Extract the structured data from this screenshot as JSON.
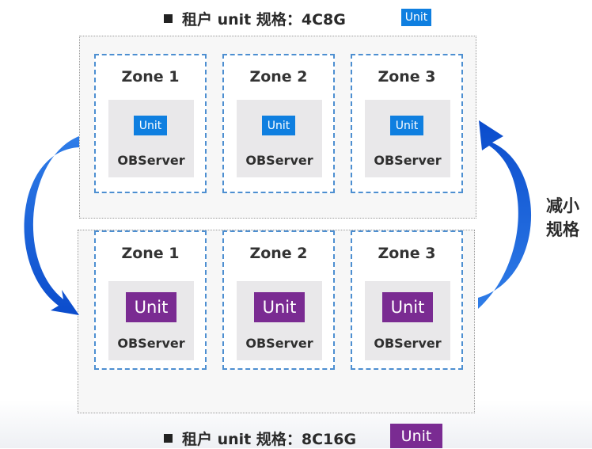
{
  "top_caption": {
    "text": "租户 unit 规格：4C8G",
    "badge": "Unit",
    "badge_color": "#0f7fe0"
  },
  "bottom_caption": {
    "text": "租户 unit 规格：8C16G",
    "badge": "Unit",
    "badge_color": "#7a2b92"
  },
  "side_label": {
    "line1": "减小",
    "line2": "规格"
  },
  "top_group": {
    "zones": [
      {
        "name": "Zone 1",
        "unit": "Unit",
        "server": "OBServer"
      },
      {
        "name": "Zone 2",
        "unit": "Unit",
        "server": "OBServer"
      },
      {
        "name": "Zone 3",
        "unit": "Unit",
        "server": "OBServer"
      }
    ]
  },
  "bottom_group": {
    "zones": [
      {
        "name": "Zone 1",
        "unit": "Unit",
        "server": "OBServer"
      },
      {
        "name": "Zone 2",
        "unit": "Unit",
        "server": "OBServer"
      },
      {
        "name": "Zone 3",
        "unit": "Unit",
        "server": "OBServer"
      }
    ]
  },
  "colors": {
    "arrow": "#1763dc",
    "zone_border": "#4d8fd1",
    "small_unit": "#0f7fe0",
    "large_unit": "#7a2b92"
  }
}
